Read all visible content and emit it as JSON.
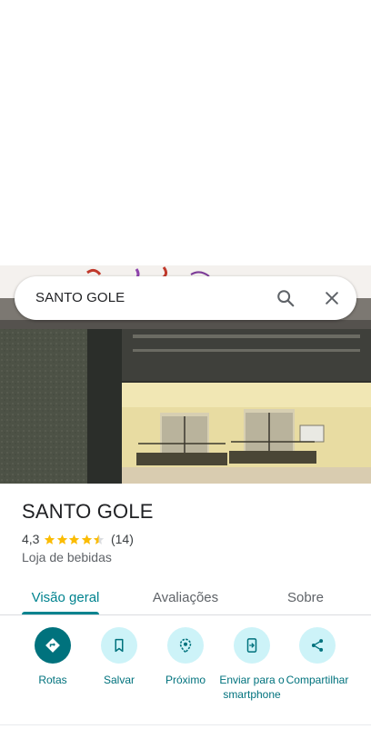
{
  "search": {
    "query": "SANTO GOLE",
    "search_icon": "search-icon",
    "close_icon": "close-icon"
  },
  "place": {
    "name": "SANTO GOLE",
    "rating": "4,3",
    "rating_fraction": 0.86,
    "stars_filled": 4.5,
    "review_count": "(14)",
    "category": "Loja de bebidas"
  },
  "tabs": [
    {
      "label": "Visão geral",
      "selected": true
    },
    {
      "label": "Avaliações",
      "selected": false
    },
    {
      "label": "Sobre",
      "selected": false
    }
  ],
  "actions": [
    {
      "label": "Rotas",
      "icon": "directions-icon"
    },
    {
      "label": "Salvar",
      "icon": "bookmark-icon"
    },
    {
      "label": "Próximo",
      "icon": "nearby-icon"
    },
    {
      "label": "Enviar para o smartphone",
      "icon": "send-to-phone-icon"
    },
    {
      "label": "Compartilhar",
      "icon": "share-icon"
    }
  ],
  "colors": {
    "accent": "#00838f",
    "action_primary": "#00727d",
    "action_secondary_bg": "#cdf3f8",
    "star": "#fbbc04"
  }
}
